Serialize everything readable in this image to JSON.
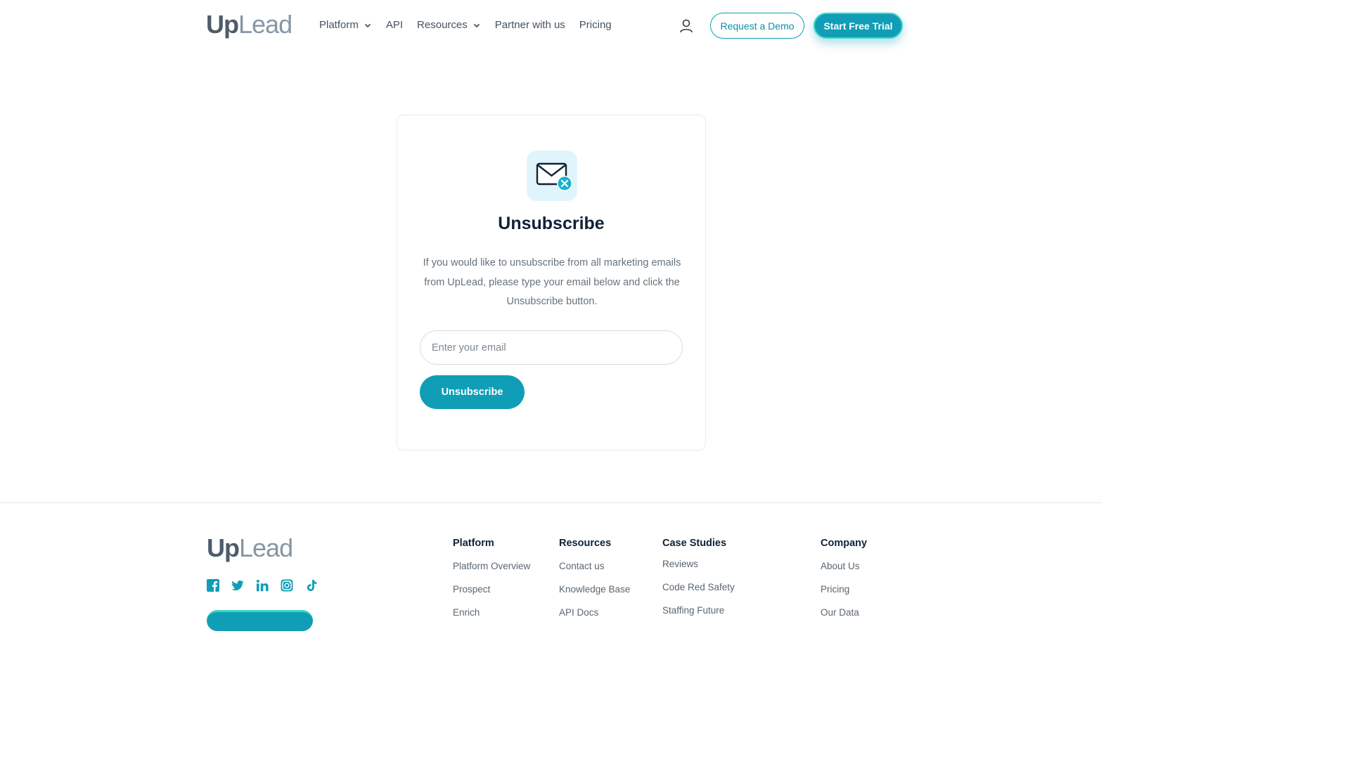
{
  "brand": {
    "logo_up": "Up",
    "logo_lead": "Lead",
    "accent": "#0f9eb6"
  },
  "header": {
    "nav": [
      {
        "label": "Platform",
        "has_dropdown": true
      },
      {
        "label": "API",
        "has_dropdown": false
      },
      {
        "label": "Resources",
        "has_dropdown": true
      },
      {
        "label": "Partner with us",
        "has_dropdown": false
      },
      {
        "label": "Pricing",
        "has_dropdown": false
      }
    ],
    "user_icon": "user-icon",
    "demo_label": "Request a Demo",
    "trial_label": "Start Free Trial"
  },
  "unsubscribe": {
    "icon": "mail-unsubscribe-icon",
    "title": "Unsubscribe",
    "description": "If you would like to unsubscribe from all marketing emails from UpLead, please type your email below and click the Unsubscribe button.",
    "email_value": "",
    "email_placeholder": "Enter your email",
    "button_label": "Unsubscribe"
  },
  "footer": {
    "social": [
      "facebook-icon",
      "twitter-icon",
      "linkedin-icon",
      "instagram-icon",
      "tiktok-icon"
    ],
    "columns": [
      {
        "title": "Platform",
        "links": [
          "Platform Overview",
          "Prospect",
          "Enrich"
        ]
      },
      {
        "title": "Resources",
        "links": [
          "Contact us",
          "Knowledge Base",
          "API Docs"
        ]
      },
      {
        "title": "Case Studies",
        "links": [
          "Reviews",
          "Code Red Safety",
          "Staffing Future"
        ]
      },
      {
        "title": "Company",
        "links": [
          "About Us",
          "Pricing",
          "Our Data"
        ]
      }
    ]
  }
}
